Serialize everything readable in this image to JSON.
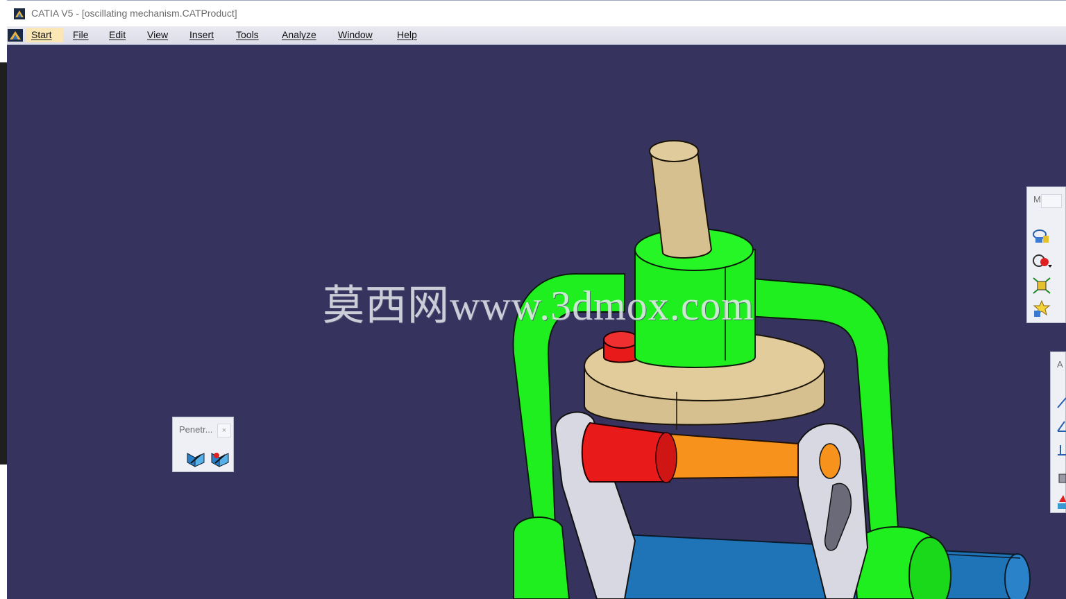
{
  "window": {
    "title": "CATIA V5 - [oscillating mechanism.CATProduct]",
    "icon": "catia-app-icon"
  },
  "menubar": {
    "items": [
      {
        "label": "Start"
      },
      {
        "label": "File"
      },
      {
        "label": "Edit"
      },
      {
        "label": "View"
      },
      {
        "label": "Insert"
      },
      {
        "label": "Tools"
      },
      {
        "label": "Analyze"
      },
      {
        "label": "Window"
      },
      {
        "label": "Help"
      }
    ]
  },
  "toolbars": {
    "penetration": {
      "title": "Penetr...",
      "close": "×",
      "buttons": [
        "penetration-icon",
        "penetration-result-icon"
      ]
    },
    "right_top": {
      "title": "M",
      "buttons": [
        "move-icon",
        "snap-icon",
        "fit-icon",
        "explode-icon"
      ]
    },
    "right_bottom": {
      "title": "A",
      "buttons": [
        "constraint-icon",
        "angle-constraint-icon",
        "offset-constraint-icon",
        "fix-icon",
        "update-icon"
      ]
    }
  },
  "watermark": "莫西网www.3dmox.com",
  "colors": {
    "viewport_background": "#36345f",
    "frame_green": "#1fef1f",
    "disk_tan": "#d7c08f",
    "pin_red": "#e81a1a",
    "rod_orange": "#f7931d",
    "shaft_blue": "#1f74b8",
    "link_gray": "#d8d8e2"
  }
}
